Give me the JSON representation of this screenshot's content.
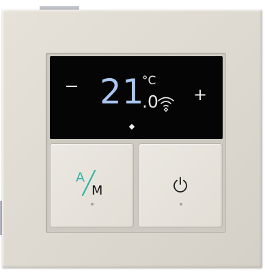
{
  "display": {
    "decrease_symbol": "–",
    "temperature_whole": "21",
    "temperature_unit": "°C",
    "temperature_decimal": ".0",
    "increase_symbol": "+",
    "wifi_icon": "wifi-icon",
    "indicator_icon": "diamond-icon"
  },
  "keys": {
    "mode": {
      "label_a": "A",
      "label_m": "M",
      "icon": "auto-manual-icon"
    },
    "power": {
      "icon": "power-icon"
    }
  },
  "colors": {
    "temperature_digits": "#a9c7f0",
    "mode_accent": "#35b3a6",
    "screen": "#050505",
    "plate": "#e1ddd5"
  }
}
